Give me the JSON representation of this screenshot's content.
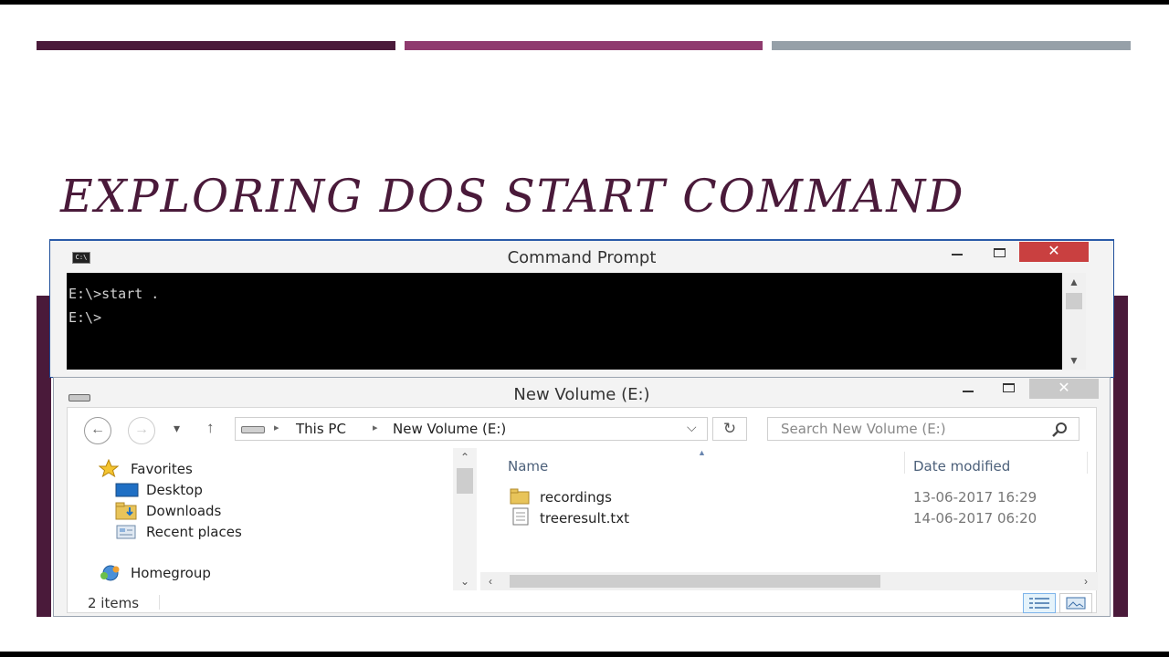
{
  "slide": {
    "title": "EXPLORING DOS START COMMAND",
    "colors": {
      "bar1": "#4a1a3a",
      "bar2": "#8f3a6e",
      "bar3": "#96a0a8",
      "title": "#4a1a3a"
    }
  },
  "cmd_window": {
    "icon_text": "C:\\",
    "title": "Command Prompt",
    "minimize_icon": "minimize-icon",
    "maximize_icon": "maximize-icon",
    "close_label": "✕",
    "lines": [
      "E:\\>start .",
      "E:\\>"
    ]
  },
  "explorer_window": {
    "title": "New Volume (E:)",
    "close_label": "✕",
    "nav": {
      "back": "←",
      "forward": "→",
      "recent": "▾",
      "up": "↑"
    },
    "address": {
      "items": [
        "This PC",
        "New Volume (E:)"
      ],
      "separator": "▸",
      "dropdown": "⌵"
    },
    "refresh": "↻",
    "search_placeholder": "Search New Volume (E:)",
    "sidebar": {
      "favorites": "Favorites",
      "items": [
        "Desktop",
        "Downloads",
        "Recent places"
      ],
      "homegroup": "Homegroup"
    },
    "columns": {
      "name": "Name",
      "date_modified": "Date modified"
    },
    "files": [
      {
        "name": "recordings",
        "type": "folder",
        "date": "13-06-2017 16:29"
      },
      {
        "name": "treeresult.txt",
        "type": "text-file",
        "date": "14-06-2017 06:20"
      }
    ],
    "status": {
      "count": "2 items",
      "views": [
        "details-view",
        "large-icons-view"
      ]
    }
  }
}
